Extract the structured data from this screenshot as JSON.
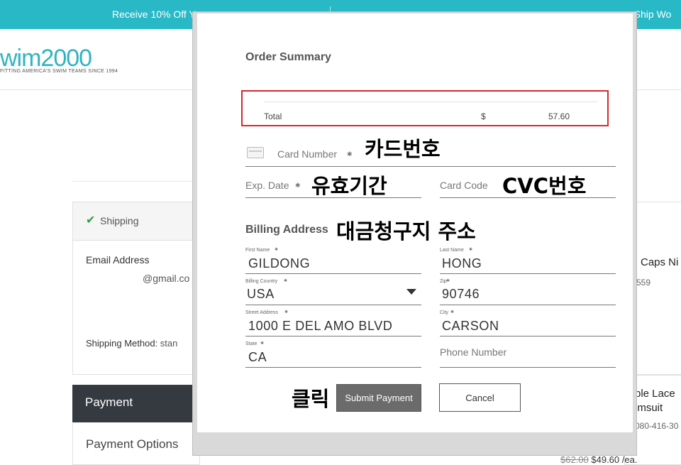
{
  "site": {
    "promo_left": "Receive 10% Off Y",
    "promo_right": "e Ship Wo",
    "logo": "wim2000",
    "logo_tagline": "FITTING AMERICA'S SWIM TEAMS SINCE 1994",
    "shipping_label": "Shipping",
    "email_label": "Email Address",
    "email_value": "@gmail.co",
    "shipping_method_label": "Shipping Method:",
    "shipping_method_value": " stan",
    "payment_label": "Payment",
    "payment_options_label": "Payment Options",
    "product1_title": "Caps Ni",
    "product1_sku": "559",
    "product2_title_line1": "ble Lace",
    "product2_title_line2": "imsuit",
    "product2_sku": "080-416-30",
    "product2_old_price": "$62.00",
    "product2_price": " $49.60 /ea."
  },
  "modal": {
    "title": "Order Summary",
    "total_label": "Total",
    "total_currency": "$",
    "total_amount": "57.60",
    "card_number_placeholder": "Card Number",
    "exp_date_placeholder": "Exp. Date",
    "card_code_placeholder": "Card Code",
    "required_mark": "✱",
    "billing_title": "Billing Address",
    "first_name_label": "First Name",
    "first_name_value": "GILDONG",
    "last_name_label": "Last Name",
    "last_name_value": "HONG",
    "country_label": "Billing Country",
    "country_value": "USA",
    "zip_label": "Zip",
    "zip_value": "90746",
    "street_label": "Street Address",
    "street_value": "1000 E DEL AMO BLVD",
    "city_label": "City",
    "city_value": "CARSON",
    "state_label": "State",
    "state_value": "CA",
    "phone_placeholder": "Phone Number",
    "submit_label": "Submit Payment",
    "cancel_label": "Cancel"
  },
  "annotations": {
    "card_number": "카드번호",
    "expiry": "유효기간",
    "cvc": "CVC번호",
    "billing": "대금청구지 주소",
    "click": "클릭"
  },
  "colors": {
    "promo_bar": "#29b9c6",
    "highlight_border": "#d9262c",
    "submit_button": "#6b6b6b",
    "payment_bar": "#353a40"
  }
}
